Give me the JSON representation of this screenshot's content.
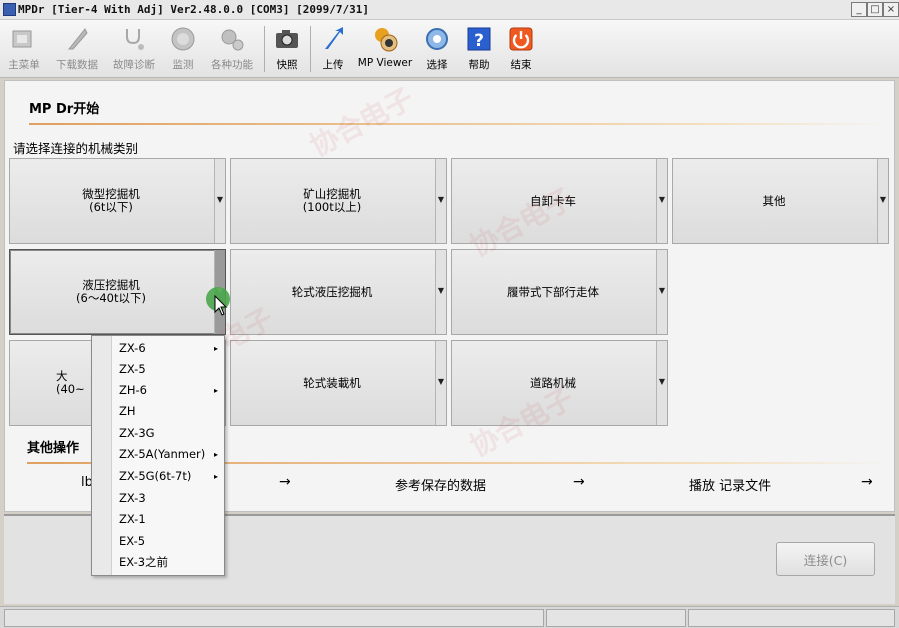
{
  "window": {
    "title": "MPDr [Tier-4 With Adj] Ver2.48.0.0 [COM3] [2099/7/31]",
    "controls": [
      "_",
      "□",
      "×"
    ]
  },
  "toolbar": {
    "items": [
      {
        "label": "主菜单",
        "icon": "home-icon",
        "enabled": false
      },
      {
        "label": "下载数据",
        "icon": "download-icon",
        "enabled": false
      },
      {
        "label": "故障诊断",
        "icon": "stethoscope-icon",
        "enabled": false
      },
      {
        "label": "监测",
        "icon": "gauge-icon",
        "enabled": false
      },
      {
        "label": "各种功能",
        "icon": "gears-icon",
        "enabled": false
      },
      {
        "label": "快照",
        "icon": "camera-icon",
        "enabled": true
      },
      {
        "label": "上传",
        "icon": "upload-icon",
        "enabled": true
      },
      {
        "label": "MP Viewer",
        "icon": "viewer-icon",
        "enabled": true
      },
      {
        "label": "选择",
        "icon": "select-gear-icon",
        "enabled": true
      },
      {
        "label": "帮助",
        "icon": "help-icon",
        "enabled": true
      },
      {
        "label": "结束",
        "icon": "power-icon",
        "enabled": true
      }
    ]
  },
  "main": {
    "title": "MP Dr开始",
    "prompt": "请选择连接的机械类别",
    "categories": [
      {
        "line1": "微型挖掘机",
        "line2": "(6t以下)"
      },
      {
        "line1": "矿山挖掘机",
        "line2": "(100t以上)"
      },
      {
        "line1": "自卸卡车",
        "line2": ""
      },
      {
        "line1": "其他",
        "line2": ""
      },
      {
        "line1": "液压挖掘机",
        "line2": "(6～40t以下)"
      },
      {
        "line1": "轮式液压挖掘机",
        "line2": ""
      },
      {
        "line1": "履带式下部行走体",
        "line2": ""
      },
      {
        "line1": "大",
        "line2": "(40~"
      },
      {
        "line1": "轮式装載机",
        "line2": ""
      },
      {
        "line1": "道路机械",
        "line2": ""
      }
    ],
    "other_title": "其他操作",
    "other_ops": [
      "lb",
      "参考保存的数据",
      "播放 记录文件"
    ],
    "arrow": "→"
  },
  "popup_menu": {
    "items": [
      {
        "label": "ZX-6",
        "submenu": true
      },
      {
        "label": "ZX-5",
        "submenu": false
      },
      {
        "label": "ZH-6",
        "submenu": true
      },
      {
        "label": "ZH",
        "submenu": false
      },
      {
        "label": "ZX-3G",
        "submenu": false
      },
      {
        "label": "ZX-5A(Yanmer)",
        "submenu": true
      },
      {
        "label": "ZX-5G(6t-7t)",
        "submenu": true
      },
      {
        "label": "ZX-3",
        "submenu": false
      },
      {
        "label": "ZX-1",
        "submenu": false
      },
      {
        "label": "EX-5",
        "submenu": false
      },
      {
        "label": "EX-3之前",
        "submenu": false
      }
    ],
    "submenu_glyph": "▸"
  },
  "bottom": {
    "connect_label": "连接(C)"
  },
  "watermark": "协合电子",
  "colors": {
    "accent_rule": "#e0a060",
    "disabled_text": "#8a8a8a",
    "selected_drop": "#9a9a9a"
  }
}
